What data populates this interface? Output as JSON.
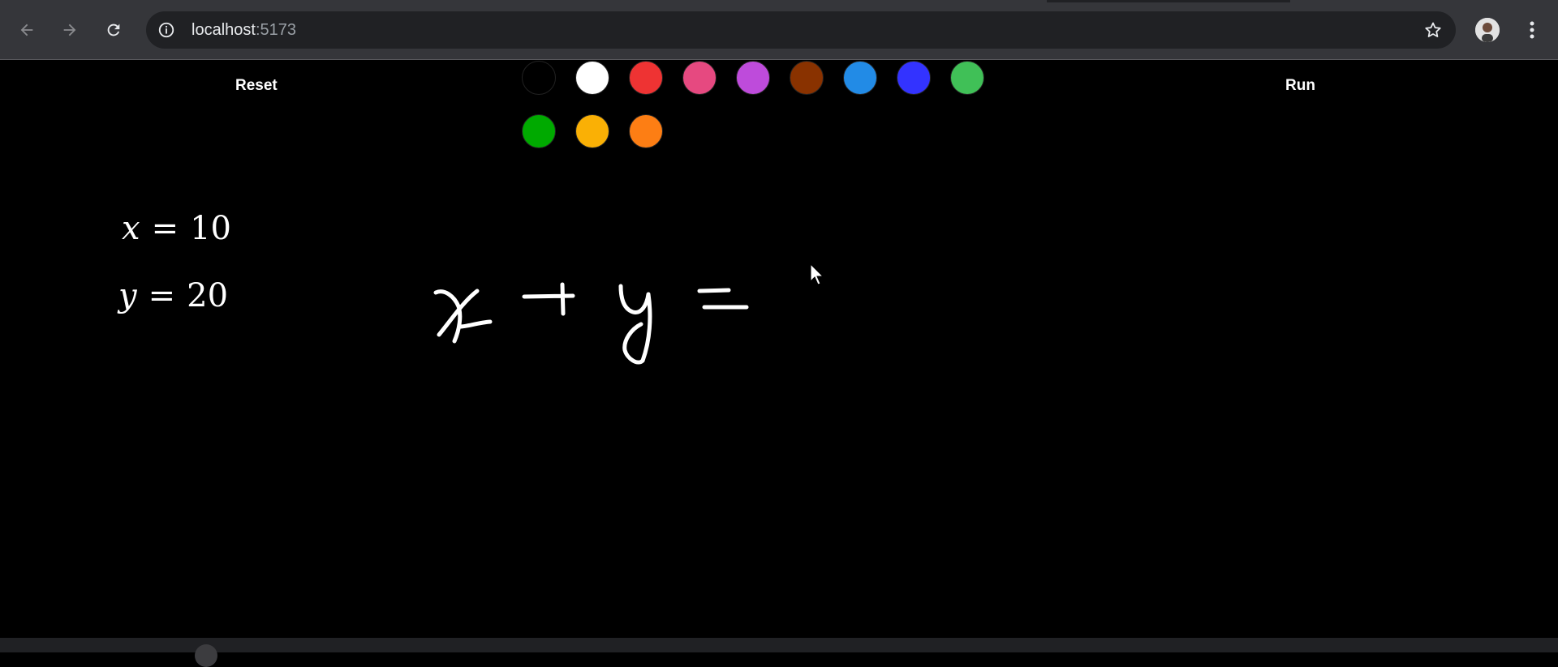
{
  "browser": {
    "url_host": "localhost",
    "url_port": ":5173"
  },
  "toolbar": {
    "reset_label": "Reset",
    "run_label": "Run"
  },
  "swatches": [
    "#000000",
    "#ffffff",
    "#ee3333",
    "#e64980",
    "#be4bdb",
    "#893200",
    "#228be6",
    "#3333ff",
    "#40c057",
    "#00aa00",
    "#fab005",
    "#fd7e14"
  ],
  "results": [
    {
      "variable": "x",
      "equals": "=",
      "value": "10"
    },
    {
      "variable": "y",
      "equals": "=",
      "value": "20"
    }
  ],
  "drawing": {
    "handwritten_content": "x + y ="
  }
}
